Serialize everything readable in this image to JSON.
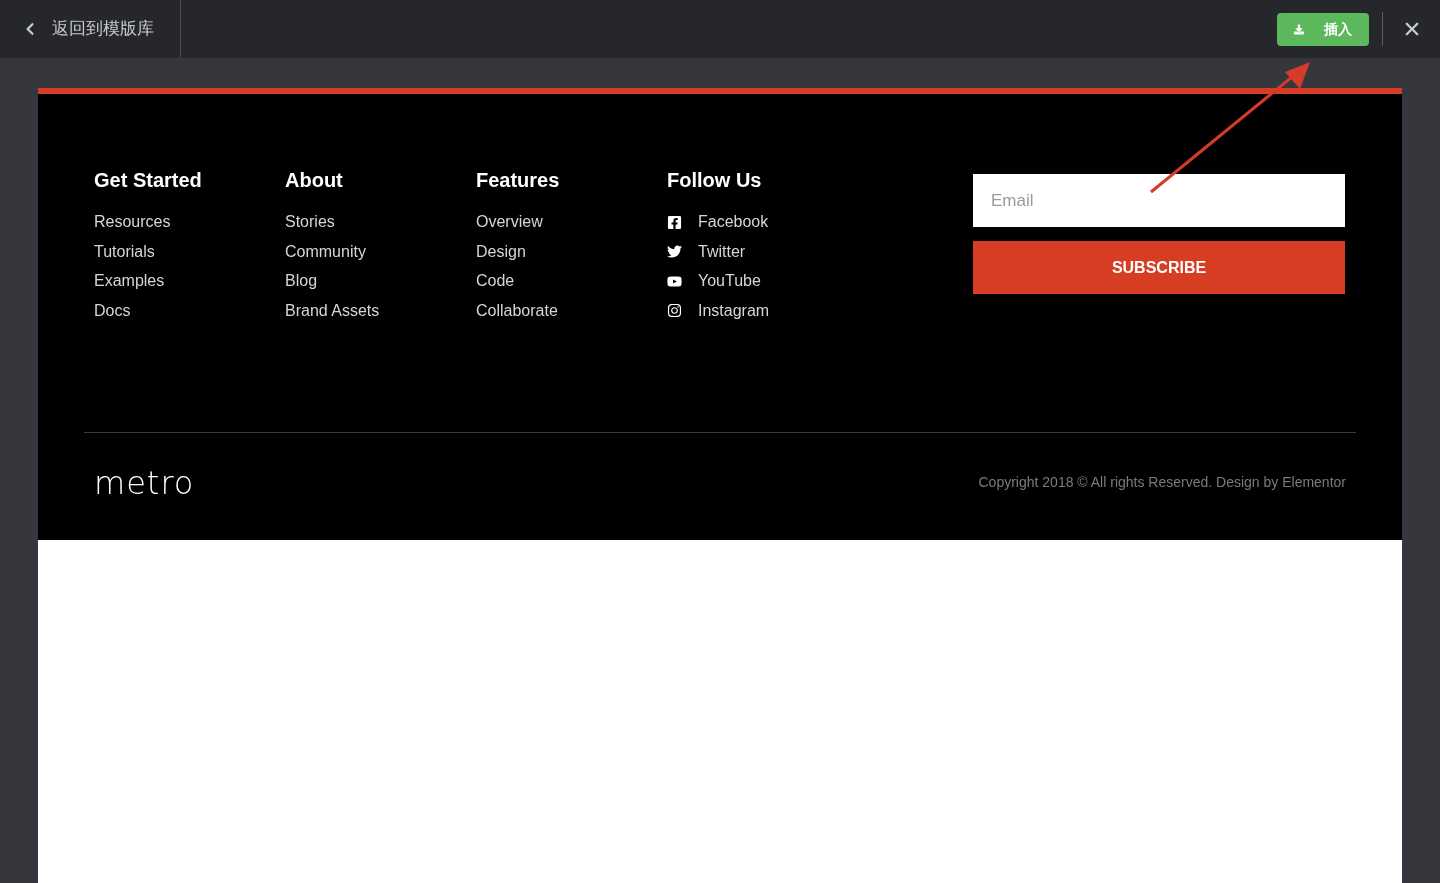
{
  "top_bar": {
    "back_label": "返回到模版库",
    "insert_button": "插入"
  },
  "footer": {
    "columns": [
      {
        "title": "Get Started",
        "links": [
          "Resources",
          "Tutorials",
          "Examples",
          "Docs"
        ]
      },
      {
        "title": "About",
        "links": [
          "Stories",
          "Community",
          "Blog",
          "Brand Assets"
        ]
      },
      {
        "title": "Features",
        "links": [
          "Overview",
          "Design",
          "Code",
          "Collaborate"
        ]
      }
    ],
    "social": {
      "title": "Follow Us",
      "links": [
        "Facebook",
        "Twitter",
        "YouTube",
        "Instagram"
      ]
    },
    "newsletter": {
      "placeholder": "Email",
      "button": "SUBSCRIBE"
    },
    "logo": "metro",
    "copyright": "Copyright 2018 © All rights Reserved. Design by Elementor"
  }
}
